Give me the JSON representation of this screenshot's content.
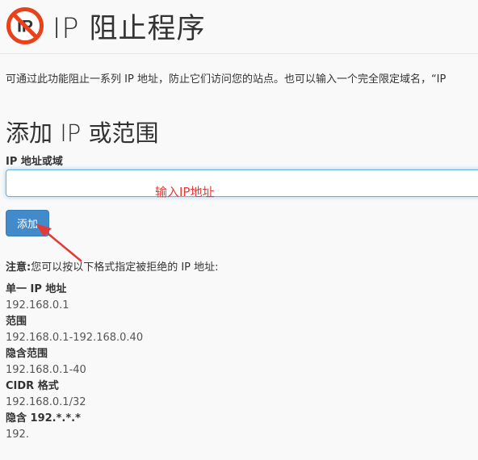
{
  "header": {
    "title": "IP 阻止程序",
    "logo_text": "IP",
    "logo_icon": "ip-blocker-no-symbol-icon"
  },
  "description": "可通过此功能阻止一系列 IP 地址，防止它们访问您的站点。也可以输入一个完全限定域名，“IP",
  "add_section": {
    "title": "添加 IP 或范围",
    "field_label": "IP 地址或域",
    "input_value": "",
    "add_button_label": "添加"
  },
  "annotation": {
    "text": "输入IP地址",
    "color": "#e53935"
  },
  "note": {
    "label": "注意:",
    "text": "您可以按以下格式指定被拒绝的 IP 地址:"
  },
  "formats": [
    {
      "heading": "单一 IP 地址",
      "example": "192.168.0.1"
    },
    {
      "heading": "范围",
      "example": "192.168.0.1-192.168.0.40"
    },
    {
      "heading": "隐含范围",
      "example": "192.168.0.1-40"
    },
    {
      "heading": "CIDR 格式",
      "example": "192.168.0.1/32"
    },
    {
      "heading": "隐含 192.*.*.*",
      "example": "192."
    }
  ],
  "colors": {
    "accent": "#428bca",
    "logo_red": "#e8421c",
    "logo_dark": "#333333"
  }
}
